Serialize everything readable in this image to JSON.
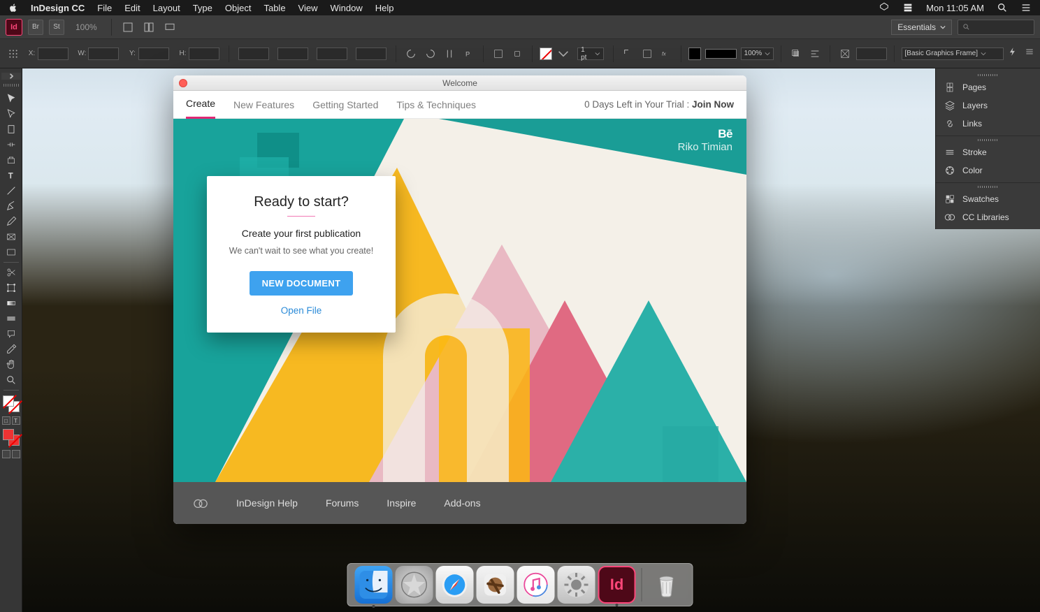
{
  "menubar": {
    "app_name": "InDesign CC",
    "items": [
      "File",
      "Edit",
      "Layout",
      "Type",
      "Object",
      "Table",
      "View",
      "Window",
      "Help"
    ],
    "clock": "Mon 11:05 AM"
  },
  "appbar": {
    "bridge_label": "Br",
    "stock_label": "St",
    "zoom": "100%",
    "workspace": "Essentials",
    "xy": {
      "x_label": "X:",
      "y_label": "Y:",
      "w_label": "W:",
      "h_label": "H:"
    },
    "stroke_weight": "1 pt",
    "opacity": "100%",
    "object_style": "[Basic Graphics Frame]"
  },
  "right_panels": {
    "group1": [
      "Pages",
      "Layers",
      "Links"
    ],
    "group2": [
      "Stroke",
      "Color"
    ],
    "group3": [
      "Swatches",
      "CC Libraries"
    ]
  },
  "welcome": {
    "title": "Welcome",
    "tabs": [
      "Create",
      "New Features",
      "Getting Started",
      "Tips & Techniques"
    ],
    "active_tab": "Create",
    "trial_text": "0 Days Left in Your Trial : ",
    "trial_cta": "Join Now",
    "behance_logo": "Bē",
    "artist": "Riko Timian",
    "card": {
      "heading": "Ready to start?",
      "sub": "Create your first publication",
      "desc": "We can't wait to see what you create!",
      "new_doc": "NEW DOCUMENT",
      "open_file": "Open File"
    },
    "footer": [
      "InDesign Help",
      "Forums",
      "Inspire",
      "Add-ons"
    ]
  },
  "dock": {
    "indesign_label": "Id"
  }
}
